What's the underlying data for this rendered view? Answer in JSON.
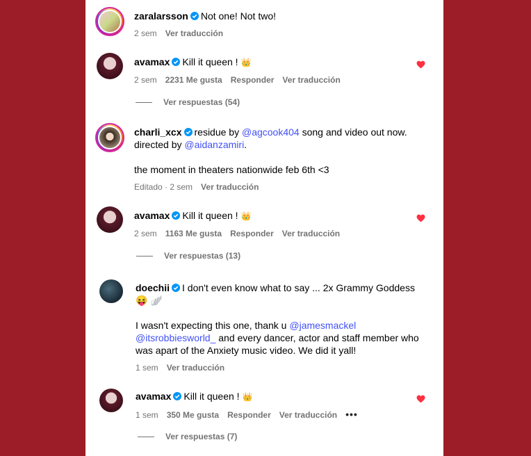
{
  "colors": {
    "background": "#9c1c27",
    "link": "#4150f7",
    "heart": "#ff3040",
    "verified": "#0095f6"
  },
  "comments": [
    {
      "username": "zaralarsson",
      "text": "Not one! Not two!",
      "time": "2 sem",
      "translate": "Ver traducción"
    },
    {
      "username": "avamax",
      "text": "Kill it queen ! ",
      "emoji": "👑",
      "time": "2 sem",
      "likes": "2231 Me gusta",
      "reply": "Responder",
      "translate": "Ver traducción",
      "view_replies": "Ver respuestas (54)"
    },
    {
      "username": "charli_xcx",
      "text_before": "residue by ",
      "mention1": "@agcook404",
      "text_mid": " song and video out now. directed by ",
      "mention2": "@aidanzamiri",
      "text_after": ".",
      "text2": "the moment in theaters nationwide feb 6th <3",
      "time": "Editado · 2 sem",
      "translate": "Ver traducción"
    },
    {
      "username": "avamax",
      "text": "Kill it queen ! ",
      "emoji": "👑",
      "time": "2 sem",
      "likes": "1163 Me gusta",
      "reply": "Responder",
      "translate": "Ver traducción",
      "view_replies": "Ver respuestas (13)"
    },
    {
      "username": "doechii",
      "text": "I don't even know what to say ... 2x Grammy Goddess",
      "emoji": "😝 🪽",
      "text2_before": "I wasn't expecting this one, thank u ",
      "mention1": "@jamesmackel",
      "mention2": "@itsrobbiesworld_",
      "text2_after": " and every dancer, actor and staff member who was apart of the Anxiety music video. We did it yall!",
      "time": "1 sem",
      "translate": "Ver traducción"
    },
    {
      "username": "avamax",
      "text": "Kill it queen ! ",
      "emoji": "👑",
      "time": "1 sem",
      "likes": "350 Me gusta",
      "reply": "Responder",
      "translate": "Ver traducción",
      "more": "•••",
      "view_replies": "Ver respuestas (7)"
    }
  ]
}
